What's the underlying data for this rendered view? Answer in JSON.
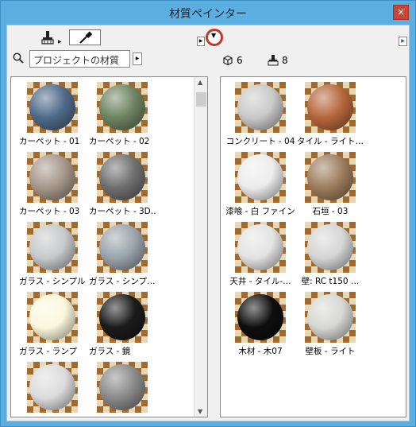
{
  "window": {
    "title": "材質ペインター",
    "close_glyph": "×"
  },
  "toolbar": {
    "brush_icon": "paint-brush-icon",
    "eyedropper_icon": "eyedropper-icon",
    "left_expand_glyph": "▶",
    "dropdown_glyph": "▼",
    "right_expand_glyph": "▶"
  },
  "search": {
    "value": "プロジェクトの材質",
    "arrow_glyph": "▶"
  },
  "counts": {
    "objects": "6",
    "painted": "8"
  },
  "left_panel": {
    "scroll_up": "▲",
    "scroll_down": "▼",
    "materials": [
      {
        "label": "カーペット - 01",
        "color": "#4f6a8a"
      },
      {
        "label": "カーペット - 02",
        "color": "#6e8461"
      },
      {
        "label": "カーペット - 03",
        "color": "#a5978a"
      },
      {
        "label": "カーペット - 3D…",
        "color": "#6f6f6f"
      },
      {
        "label": "ガラス - シンプル",
        "color": "#c7c9ca"
      },
      {
        "label": "ガラス - シンプ…",
        "color": "#9aa4ab"
      },
      {
        "label": "ガラス - ランプ",
        "color": "#fbf7dc"
      },
      {
        "label": "ガラス - 鏡",
        "color": "#1b1b1b"
      },
      {
        "label": "",
        "color": "#dcdcdc"
      },
      {
        "label": "",
        "color": "#8a8a8a"
      }
    ]
  },
  "right_panel": {
    "materials": [
      {
        "label": "コンクリート - 04",
        "color": "#c9c9c9"
      },
      {
        "label": "タイル - ライト…",
        "color": "#b5673c"
      },
      {
        "label": "漆喰 - 白 ファイン",
        "color": "#ececec"
      },
      {
        "label": "石垣 - 03",
        "color": "#9d7d5e"
      },
      {
        "label": "天井 - タイル-…",
        "color": "#e3e3e3"
      },
      {
        "label": "壁: RC t150 …",
        "color": "#d6d6d6"
      },
      {
        "label": "木材 - 木07",
        "color": "#0e0e0e"
      },
      {
        "label": "壁板 - ライト",
        "color": "#d7d7d4"
      }
    ]
  }
}
